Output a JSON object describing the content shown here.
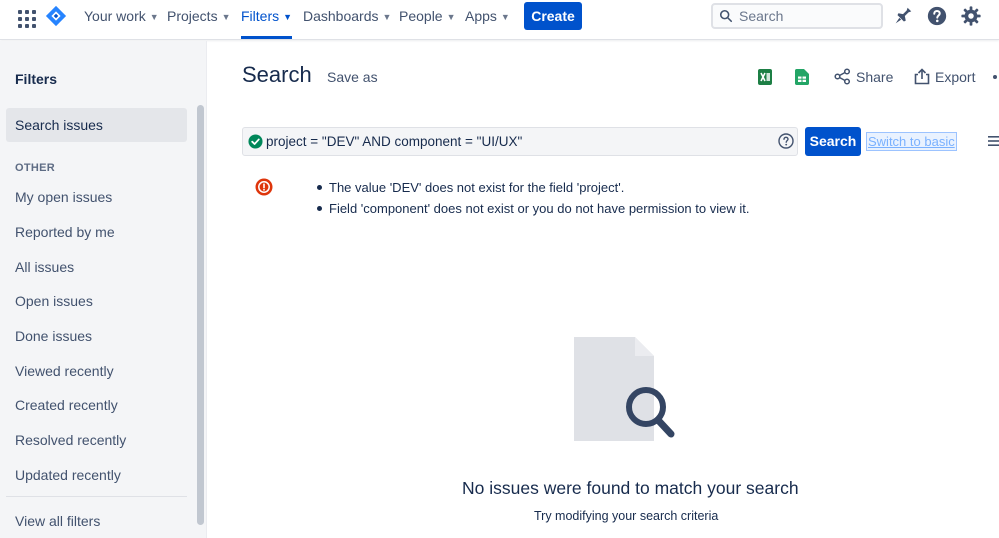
{
  "topnav": {
    "items": [
      {
        "label": "Your work",
        "active": false
      },
      {
        "label": "Projects",
        "active": false
      },
      {
        "label": "Filters",
        "active": true
      },
      {
        "label": "Dashboards",
        "active": false
      },
      {
        "label": "People",
        "active": false
      },
      {
        "label": "Apps",
        "active": false
      }
    ],
    "create_label": "Create",
    "search_placeholder": "Search",
    "icons": [
      "app-switcher-icon",
      "jira-logo-icon",
      "search-icon",
      "notifications-icon",
      "help-icon",
      "settings-icon"
    ]
  },
  "sidebar": {
    "title": "Filters",
    "selected_item": "Search issues",
    "section_label": "OTHER",
    "items": [
      "My open issues",
      "Reported by me",
      "All issues",
      "Open issues",
      "Done issues",
      "Viewed recently",
      "Created recently",
      "Resolved recently",
      "Updated recently"
    ],
    "view_all": "View all filters"
  },
  "header": {
    "title": "Search",
    "save_as": "Save as",
    "share": "Share",
    "export": "Export"
  },
  "jql": {
    "query": "project = \"DEV\" AND component = \"UI/UX\"",
    "search_button": "Search",
    "switch_link": "Switch to basic"
  },
  "errors": [
    "The value 'DEV' does not exist for the field 'project'.",
    "Field 'component' does not exist or you do not have permission to view it."
  ],
  "empty_state": {
    "title": "No issues were found to match your search",
    "subtitle": "Try modifying your search criteria"
  },
  "colors": {
    "brand": "#0052CC",
    "error": "#DE350B",
    "success": "#00875A",
    "sidebar_bg": "#F4F5F7"
  }
}
